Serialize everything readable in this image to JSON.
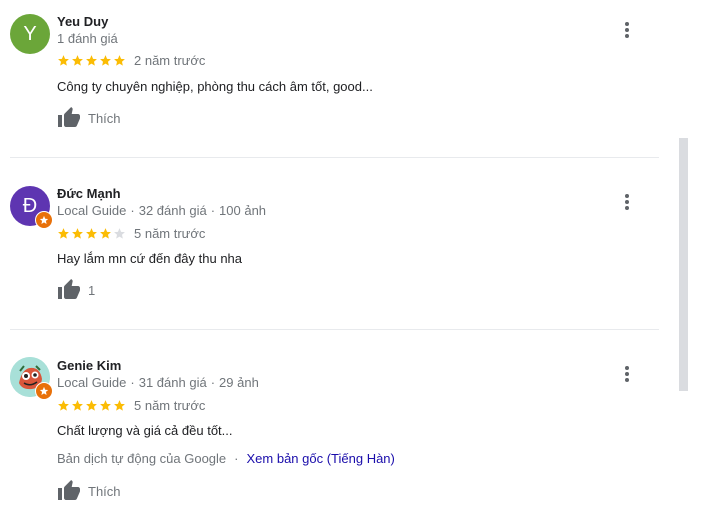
{
  "reviews": [
    {
      "avatar_letter": "Y",
      "avatar_color": "#6ba639",
      "name": "Yeu Duy",
      "meta_parts": [
        "1 đánh giá"
      ],
      "rating": 5,
      "time": "2 năm trước",
      "text": "Công ty chuyên nghiệp, phòng thu cách âm tốt, good...",
      "like_label": "Thích",
      "local_guide": false
    },
    {
      "avatar_letter": "Đ",
      "avatar_color": "#5e35b1",
      "name": "Đức Mạnh",
      "meta_parts": [
        "Local Guide",
        "32 đánh giá",
        "100 ảnh"
      ],
      "rating": 4,
      "time": "5 năm trước",
      "text": "Hay lắm mn cứ đến đây thu nha",
      "like_label": "1",
      "local_guide": true
    },
    {
      "avatar_letter": "",
      "avatar_color": "#a8e0d8",
      "name": "Genie Kim",
      "meta_parts": [
        "Local Guide",
        "31 đánh giá",
        "29 ảnh"
      ],
      "rating": 5,
      "time": "5 năm trước",
      "text": "Chất lượng và giá cả đều tốt...",
      "translate_note": "Bản dịch tự động của Google",
      "translate_dot": "·",
      "translate_link": "Xem bản gốc (Tiếng Hàn)",
      "like_label": "Thích",
      "local_guide": true
    }
  ],
  "meta_separator": "·",
  "colors": {
    "star_filled": "#fbbc04",
    "star_empty": "#dadce0",
    "link": "#1a0dab",
    "muted": "#70757a"
  },
  "icons": {
    "more": "more-vert-icon",
    "like": "thumb-up-icon",
    "star": "star-icon",
    "badge": "local-guide-star-icon"
  }
}
